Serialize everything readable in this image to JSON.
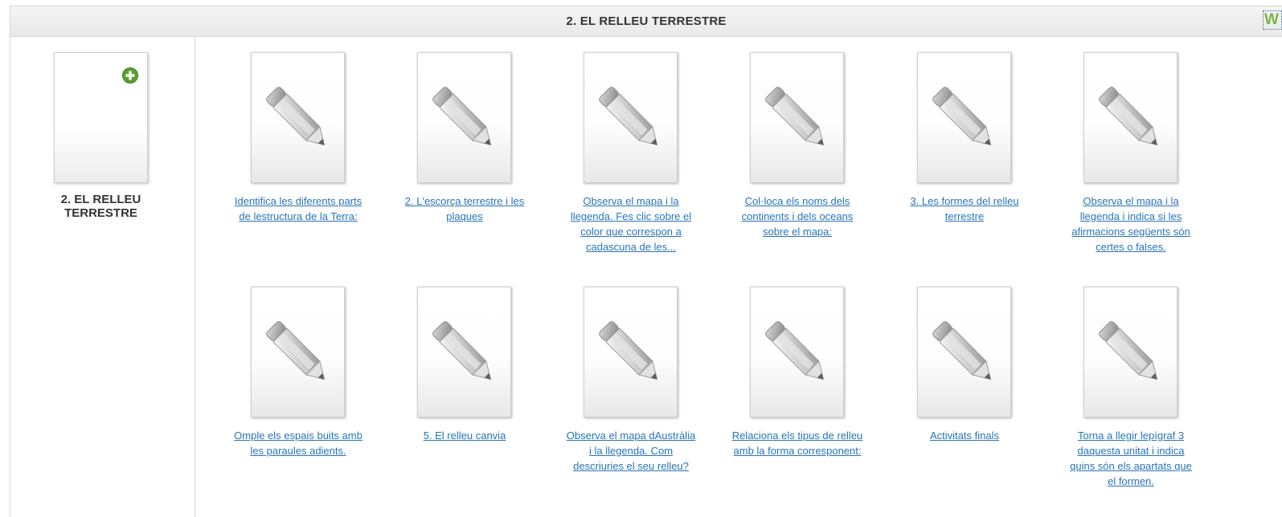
{
  "header": {
    "title": "2. EL RELLEU TERRESTRE",
    "logo_text": "W"
  },
  "sidebar": {
    "section_label": "2. EL RELLEU TERRESTRE",
    "add_icon": "plus-circle-icon"
  },
  "colors": {
    "link": "#2874b8",
    "add_icon": "#5a9e2f",
    "logo": "#7cb342"
  },
  "activities": [
    {
      "label": "Identifica les diferents parts de lestructura de la Terra:",
      "icon": "pencil-icon"
    },
    {
      "label": "2. L'escorça terrestre i les plaques",
      "icon": "pencil-icon"
    },
    {
      "label": "Observa el mapa i la llegenda. Fes clic sobre el color que correspon a cadascuna de les...",
      "icon": "pencil-icon"
    },
    {
      "label": "Col·loca els noms dels continents i dels oceans sobre el mapa:",
      "icon": "pencil-icon"
    },
    {
      "label": "3. Les formes del relleu terrestre",
      "icon": "pencil-icon"
    },
    {
      "label": "Observa el mapa i la llegenda i indica si les afirmacions següents són certes o falses.",
      "icon": "pencil-icon"
    },
    {
      "label": "Omple els espais buits amb les paraules adients.",
      "icon": "pencil-icon"
    },
    {
      "label": "5. El relleu canvia",
      "icon": "pencil-icon"
    },
    {
      "label": "Observa el mapa dAustràlia i la llegenda. Com descriuries el seu relleu?",
      "icon": "pencil-icon"
    },
    {
      "label": "Relaciona els tipus de relleu amb la forma corresponent:",
      "icon": "pencil-icon"
    },
    {
      "label": "Activitats finals",
      "icon": "pencil-icon"
    },
    {
      "label": "Torna a llegir lepígraf 3 daquesta unitat i indica quins són els apartats que el formen.",
      "icon": "pencil-icon"
    }
  ]
}
